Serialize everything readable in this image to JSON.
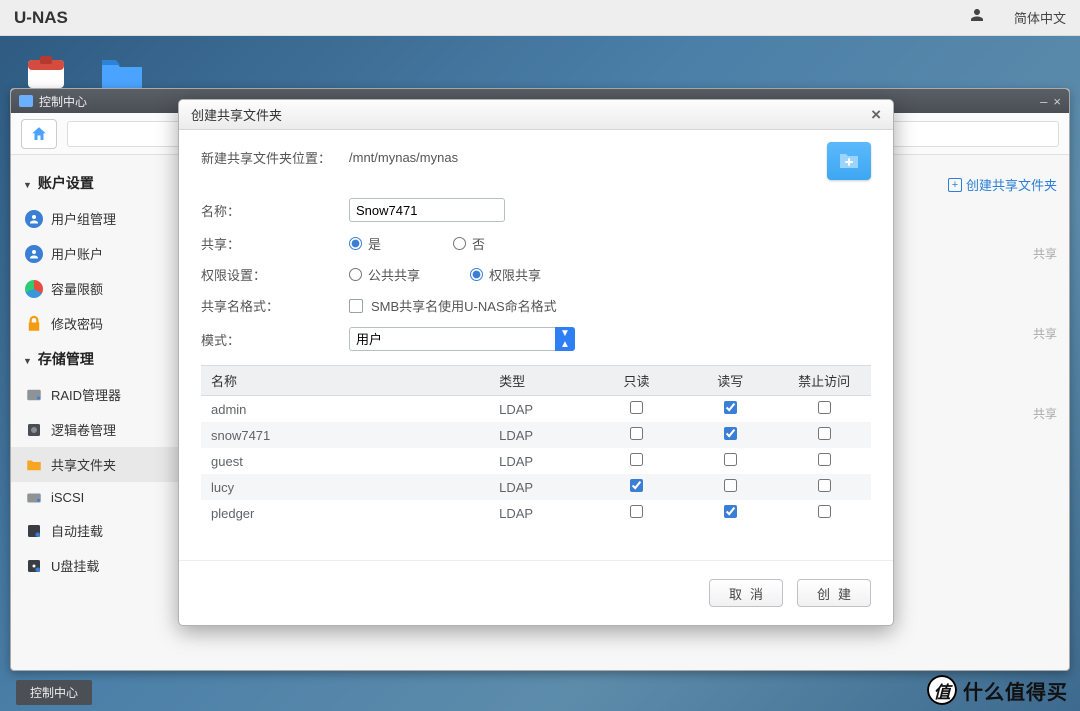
{
  "topbar": {
    "brand": "U-NAS",
    "language": "简体中文"
  },
  "cc": {
    "title": "控制中心",
    "sections": {
      "account": {
        "label": "账户设置",
        "items": [
          "用户组管理",
          "用户账户",
          "容量限额",
          "修改密码"
        ]
      },
      "storage": {
        "label": "存储管理",
        "items": [
          "RAID管理器",
          "逻辑卷管理",
          "共享文件夹",
          "iSCSI",
          "自动挂载",
          "U盘挂载"
        ]
      }
    },
    "create_link": "创建共享文件夹",
    "bg_word": "共享"
  },
  "dialog": {
    "title": "创建共享文件夹",
    "path_label": "新建共享文件夹位置：",
    "path_value": "/mnt/mynas/mynas",
    "name_label": "名称：",
    "name_value": "Snow7471",
    "share_label": "共享：",
    "share_yes": "是",
    "share_no": "否",
    "perm_label": "权限设置：",
    "perm_public": "公共共享",
    "perm_private": "权限共享",
    "format_label": "共享名格式：",
    "format_desc": "SMB共享名使用U-NAS命名格式",
    "mode_label": "模式：",
    "mode_value": "用户",
    "table": {
      "headers": [
        "名称",
        "类型",
        "只读",
        "读写",
        "禁止访问"
      ],
      "rows": [
        {
          "name": "admin",
          "type": "LDAP",
          "ro": false,
          "rw": true,
          "deny": false
        },
        {
          "name": "snow7471",
          "type": "LDAP",
          "ro": false,
          "rw": true,
          "deny": false
        },
        {
          "name": "guest",
          "type": "LDAP",
          "ro": false,
          "rw": false,
          "deny": false
        },
        {
          "name": "lucy",
          "type": "LDAP",
          "ro": true,
          "rw": false,
          "deny": false
        },
        {
          "name": "pledger",
          "type": "LDAP",
          "ro": false,
          "rw": true,
          "deny": false
        }
      ]
    },
    "cancel": "取消",
    "create": "创建"
  },
  "taskbar": {
    "item": "控制中心"
  },
  "watermark": {
    "glyph": "值",
    "text": "什么值得买"
  }
}
